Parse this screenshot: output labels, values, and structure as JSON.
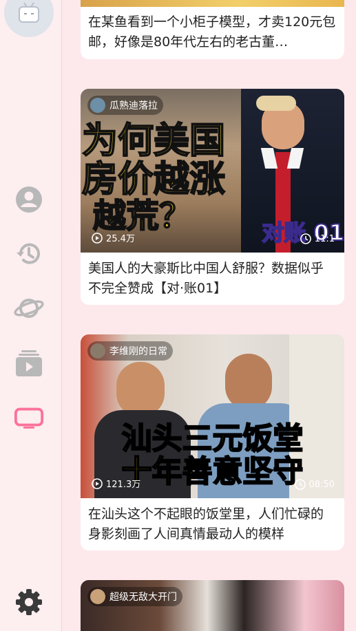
{
  "colors": {
    "background": "#fde9ec",
    "accent": "#fb7299",
    "icon_gray": "#b8b8b8",
    "settings_icon": "#3a3a3a"
  },
  "sidebar": {
    "items": [
      {
        "icon": "user-icon",
        "active": false
      },
      {
        "icon": "history-icon",
        "active": false
      },
      {
        "icon": "planet-icon",
        "active": false
      },
      {
        "icon": "video-stack-icon",
        "active": false
      },
      {
        "icon": "tv-icon",
        "active": true
      }
    ],
    "settings_icon": "gear-icon"
  },
  "feed": {
    "cards": [
      {
        "title": "在某鱼看到一个小柜子模型，才卖120元包邮，好像是80年代左右的老古董…"
      },
      {
        "uploader": "瓜熟迪落拉",
        "overlay_lines": [
          "为何美国",
          "房价越涨",
          "越荒？"
        ],
        "badge": "对账 01",
        "views": "25.4万",
        "duration": "11:1",
        "title": "美国人的大豪斯比中国人舒服？数据似乎不完全赞成【对·账01】"
      },
      {
        "uploader": "李维刚的日常",
        "overlay_lines": [
          "汕头三元饭堂",
          "十年善意坚守"
        ],
        "views": "121.3万",
        "duration": "08:50",
        "title": "在汕头这个不起眼的饭堂里，人们忙碌的身影刻画了人间真情最动人的模样"
      },
      {
        "uploader": "超级无敌大开门"
      }
    ]
  }
}
